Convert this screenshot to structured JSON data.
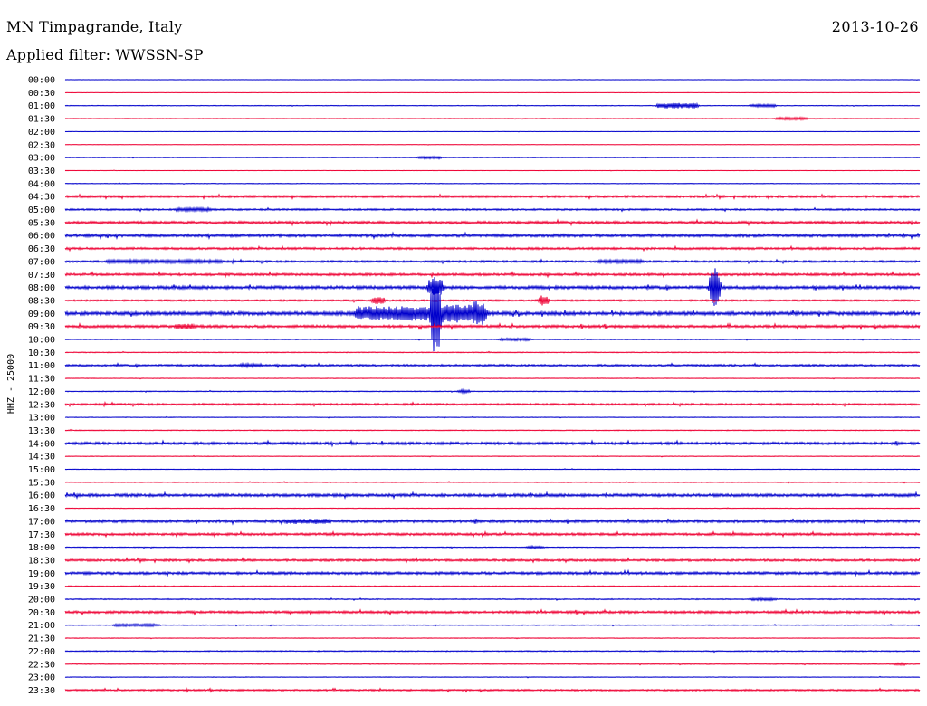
{
  "header": {
    "station": "MN Timpagrande, Italy",
    "date": "2013-10-26",
    "filter": "Applied filter: WWSSN-SP"
  },
  "chart_data": {
    "type": "line",
    "ylabel": "HHZ - 25000",
    "colors": {
      "blue": "#0000cc",
      "red": "#ee0033"
    },
    "row_labels": [
      "00:00",
      "00:30",
      "01:00",
      "01:30",
      "02:00",
      "02:30",
      "03:00",
      "03:30",
      "04:00",
      "04:30",
      "05:00",
      "05:30",
      "06:00",
      "06:30",
      "07:00",
      "07:30",
      "08:00",
      "08:30",
      "09:00",
      "09:30",
      "10:00",
      "10:30",
      "11:00",
      "11:30",
      "12:00",
      "12:30",
      "13:00",
      "13:30",
      "14:00",
      "14:30",
      "15:00",
      "15:30",
      "16:00",
      "16:30",
      "17:00",
      "17:30",
      "18:00",
      "18:30",
      "19:00",
      "19:30",
      "20:00",
      "20:30",
      "21:00",
      "21:30",
      "22:00",
      "22:30",
      "23:00",
      "23:30"
    ],
    "row_noise": [
      0.2,
      0.2,
      0.3,
      0.3,
      0.2,
      0.2,
      0.3,
      0.2,
      0.3,
      1.0,
      0.8,
      1.2,
      1.3,
      1.0,
      0.9,
      1.1,
      1.4,
      0.8,
      1.6,
      1.2,
      0.4,
      0.4,
      0.9,
      0.3,
      0.4,
      0.9,
      0.3,
      0.4,
      1.2,
      0.3,
      0.3,
      0.4,
      1.3,
      0.3,
      1.3,
      1.1,
      0.4,
      1.0,
      1.2,
      0.5,
      0.5,
      1.1,
      0.4,
      0.3,
      0.5,
      0.4,
      0.3,
      0.8
    ],
    "events": [
      {
        "row": 2,
        "minute": 21.5,
        "duration": 1.3,
        "amplitude": 3
      },
      {
        "row": 2,
        "minute": 24.5,
        "duration": 0.8,
        "amplitude": 1.5
      },
      {
        "row": 3,
        "minute": 25.5,
        "duration": 1.0,
        "amplitude": 1.5
      },
      {
        "row": 6,
        "minute": 12.8,
        "duration": 0.7,
        "amplitude": 1.5
      },
      {
        "row": 9,
        "minute": 2.0,
        "duration": 28.0,
        "amplitude": 1.0
      },
      {
        "row": 10,
        "minute": 4.5,
        "duration": 1.2,
        "amplitude": 2
      },
      {
        "row": 14,
        "minute": 3.5,
        "duration": 4.0,
        "amplitude": 2
      },
      {
        "row": 14,
        "minute": 19.5,
        "duration": 1.5,
        "amplitude": 2
      },
      {
        "row": 16,
        "minute": 13.0,
        "duration": 0.4,
        "amplitude": 10
      },
      {
        "row": 16,
        "minute": 22.8,
        "duration": 0.2,
        "amplitude": 22
      },
      {
        "row": 17,
        "minute": 11.0,
        "duration": 0.3,
        "amplitude": 4
      },
      {
        "row": 17,
        "minute": 16.8,
        "duration": 0.2,
        "amplitude": 6
      },
      {
        "row": 18,
        "minute": 11.5,
        "duration": 2.5,
        "amplitude": 8
      },
      {
        "row": 18,
        "minute": 13.0,
        "duration": 0.2,
        "amplitude": 45
      },
      {
        "row": 18,
        "minute": 14.0,
        "duration": 1.5,
        "amplitude": 10
      },
      {
        "row": 18,
        "minute": 14.5,
        "duration": 0.3,
        "amplitude": 14
      },
      {
        "row": 19,
        "minute": 4.2,
        "duration": 0.6,
        "amplitude": 3
      },
      {
        "row": 20,
        "minute": 15.8,
        "duration": 1.0,
        "amplitude": 1.5
      },
      {
        "row": 22,
        "minute": 6.5,
        "duration": 0.7,
        "amplitude": 2
      },
      {
        "row": 24,
        "minute": 14.0,
        "duration": 0.3,
        "amplitude": 2
      },
      {
        "row": 34,
        "minute": 8.5,
        "duration": 1.5,
        "amplitude": 3
      },
      {
        "row": 36,
        "minute": 16.5,
        "duration": 0.5,
        "amplitude": 1.5
      },
      {
        "row": 40,
        "minute": 24.5,
        "duration": 0.8,
        "amplitude": 1.5
      },
      {
        "row": 42,
        "minute": 2.5,
        "duration": 1.5,
        "amplitude": 1.5
      },
      {
        "row": 45,
        "minute": 29.3,
        "duration": 0.3,
        "amplitude": 1.5
      }
    ]
  }
}
